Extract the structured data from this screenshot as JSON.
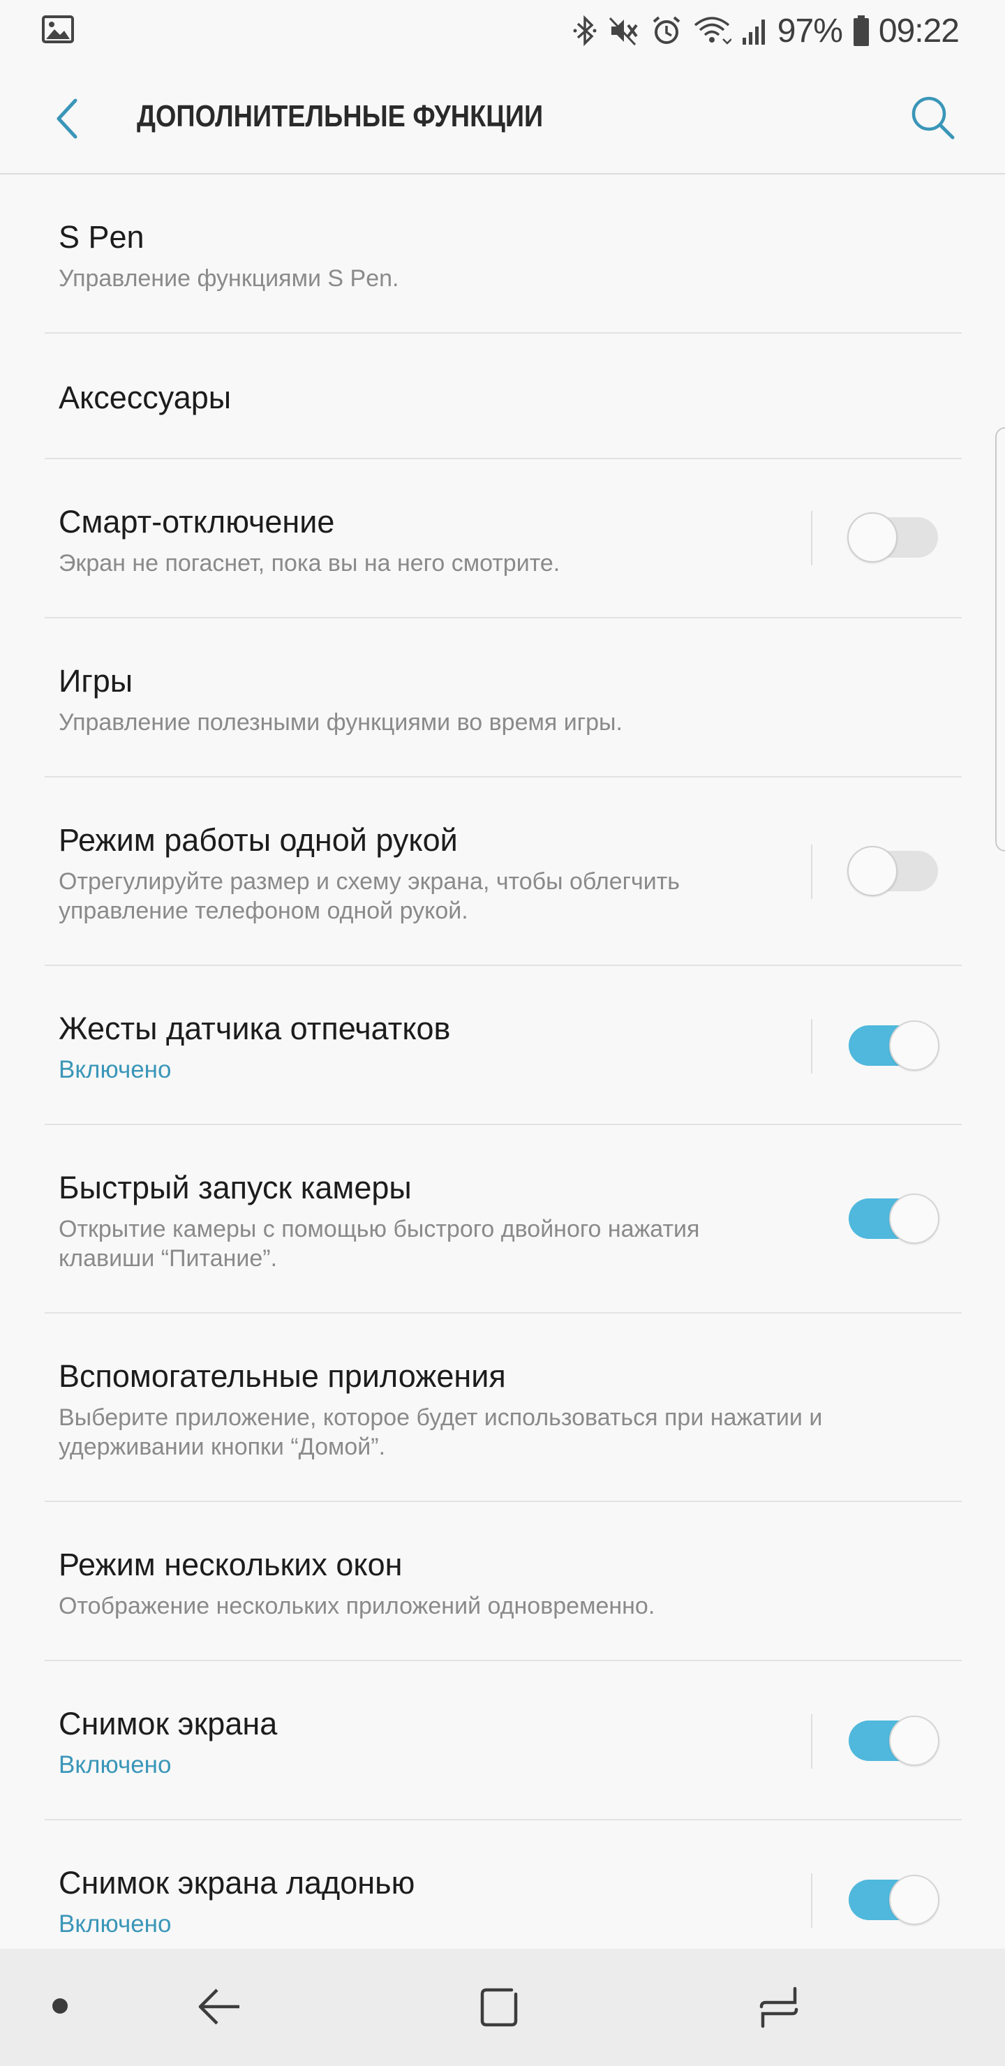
{
  "status_bar": {
    "gallery_icon": "image-icon",
    "battery_percent": "97%",
    "time": "09:22",
    "icons": [
      "bluetooth-icon",
      "mute-icon",
      "alarm-icon",
      "wifi-icon",
      "signal-icon",
      "battery-icon"
    ]
  },
  "header": {
    "title": "ДОПОЛНИТЕЛЬНЫЕ ФУНКЦИИ",
    "back_icon": "chevron-left-icon",
    "search_icon": "search-icon",
    "accent_color": "#3a96b8"
  },
  "settings": [
    {
      "title": "S Pen",
      "subtitle": "Управление функциями S Pen."
    },
    {
      "title": "Аксессуары"
    },
    {
      "title": "Смарт-отключение",
      "subtitle": "Экран не погаснет, пока вы на него смотрите.",
      "toggle": "off"
    },
    {
      "title": "Игры",
      "subtitle": "Управление полезными функциями во время игры."
    },
    {
      "title": "Режим работы одной рукой",
      "subtitle_lines": [
        "Отрегулируйте размер и схему экрана, чтобы облегчить",
        "управление телефоном одной рукой."
      ],
      "toggle": "off"
    },
    {
      "title": "Жесты датчика отпечатков",
      "status": "Включено",
      "toggle": "on"
    },
    {
      "title": "Быстрый запуск камеры",
      "subtitle_lines": [
        "Открытие камеры с помощью быстрого двойного нажатия",
        "клавиши “Питание”."
      ],
      "toggle": "on"
    },
    {
      "title": "Вспомогательные приложения",
      "subtitle_lines": [
        "Выберите приложение, которое будет использоваться при нажатии и",
        "удерживании кнопки “Домой”."
      ]
    },
    {
      "title": "Режим нескольких окон",
      "subtitle": "Отображение нескольких приложений одновременно."
    },
    {
      "title": "Снимок экрана",
      "status": "Включено",
      "toggle": "on"
    },
    {
      "title": "Снимок экрана ладонью",
      "status": "Включено",
      "toggle": "on"
    }
  ],
  "nav_bar": {
    "icons": [
      "dot-icon",
      "back-arrow-icon",
      "home-square-icon",
      "recents-icon"
    ]
  },
  "colors": {
    "background": "#f8f8f8",
    "switch_on": "#4fb8dc",
    "switch_off": "#e2e2e2",
    "status_text": "#3a96b8",
    "nav_bar": "#ececec"
  }
}
